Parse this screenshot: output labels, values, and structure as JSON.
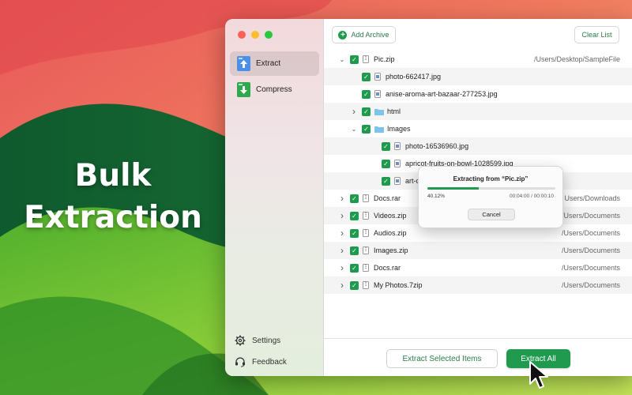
{
  "hero": {
    "line1": "Bulk",
    "line2": "Extraction"
  },
  "sidebar": {
    "items": [
      {
        "label": "Extract",
        "icon": "extract-arrow-up-icon",
        "active": true
      },
      {
        "label": "Compress",
        "icon": "compress-arrow-down-icon",
        "active": false
      }
    ],
    "settings_label": "Settings",
    "feedback_label": "Feedback"
  },
  "toolbar": {
    "add_label": "Add Archive",
    "clear_label": "Clear List"
  },
  "list": {
    "rows": [
      {
        "name": "Pic.zip",
        "path": "/Users/Desktop/SampleFile",
        "level": 0,
        "chevron": "down",
        "type": "archive"
      },
      {
        "name": "photo-662417.jpg",
        "path": "",
        "level": 1,
        "chevron": "",
        "type": "image"
      },
      {
        "name": "anise-aroma-art-bazaar-277253.jpg",
        "path": "",
        "level": 1,
        "chevron": "",
        "type": "image"
      },
      {
        "name": "html",
        "path": "",
        "level": 1,
        "chevron": "right",
        "type": "folder"
      },
      {
        "name": "Images",
        "path": "",
        "level": 1,
        "chevron": "down",
        "type": "folder"
      },
      {
        "name": "photo-16536960.jpg",
        "path": "",
        "level": 2,
        "chevron": "",
        "type": "image"
      },
      {
        "name": "apricot-fruits-on-bowl-1028599.jpg",
        "path": "",
        "level": 2,
        "chevron": "",
        "type": "image"
      },
      {
        "name": "art-c",
        "path": "",
        "level": 2,
        "chevron": "",
        "type": "image"
      },
      {
        "name": "Docs.rar",
        "path": "Users/Downloads",
        "level": 0,
        "chevron": "right",
        "type": "archive"
      },
      {
        "name": "Videos.zip",
        "path": "/Users/Documents",
        "level": 0,
        "chevron": "right",
        "type": "archive"
      },
      {
        "name": "Audios.zip",
        "path": "/Users/Documents",
        "level": 0,
        "chevron": "right",
        "type": "archive"
      },
      {
        "name": "Images.zip",
        "path": "/Users/Documents",
        "level": 0,
        "chevron": "right",
        "type": "archive"
      },
      {
        "name": "Docs.rar",
        "path": "/Users/Documents",
        "level": 0,
        "chevron": "right",
        "type": "archive"
      },
      {
        "name": "My Photos.7zip",
        "path": "/Users/Documents",
        "level": 0,
        "chevron": "right",
        "type": "archive"
      }
    ]
  },
  "dialog": {
    "title": "Extracting from “Pic.zip”",
    "percent_label": "40.12%",
    "progress": 0.4012,
    "time_label": "00:04:00 / 00:00:10",
    "cancel_label": "Cancel"
  },
  "footer": {
    "extract_selected_label": "Extract Selected Items",
    "extract_all_label": "Extract All"
  },
  "colors": {
    "accent": "#1f9a4f",
    "checkbox": "#1f9a4f"
  }
}
